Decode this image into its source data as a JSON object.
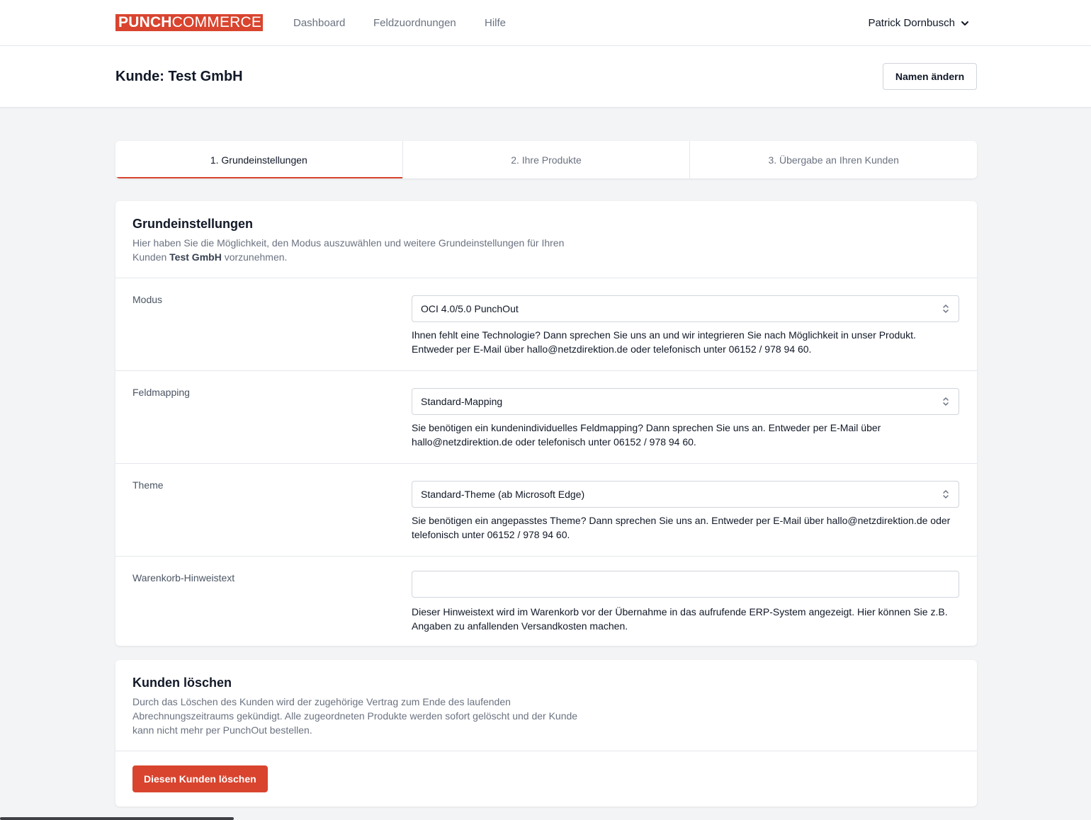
{
  "brand": {
    "logo_bold": "PUNCH",
    "logo_light": "COMMERCE",
    "color": "#d9442e"
  },
  "nav": {
    "links": [
      "Dashboard",
      "Feldzuordnungen",
      "Hilfe"
    ],
    "user": "Patrick Dornbusch"
  },
  "header": {
    "title": "Kunde: Test GmbH",
    "rename_button": "Namen ändern"
  },
  "steps": [
    {
      "label": "1. Grundeinstellungen",
      "active": true
    },
    {
      "label": "2. Ihre Produkte",
      "active": false
    },
    {
      "label": "3. Übergabe an Ihren Kunden",
      "active": false
    }
  ],
  "settings": {
    "title": "Grundeinstellungen",
    "desc_pre": "Hier haben Sie die Möglichkeit, den Modus auszuwählen und weitere Grundeinstellungen für Ihren Kunden ",
    "desc_bold": "Test GmbH",
    "desc_post": " vorzunehmen.",
    "rows": [
      {
        "label": "Modus",
        "value": "OCI 4.0/5.0 PunchOut",
        "help": "Ihnen fehlt eine Technologie? Dann sprechen Sie uns an und wir integrieren Sie nach Möglichkeit in unser Produkt. Entweder per E-Mail über hallo@netzdirektion.de oder telefonisch unter 06152 / 978 94 60."
      },
      {
        "label": "Feldmapping",
        "value": "Standard-Mapping",
        "help": "Sie benötigen ein kundenindividuelles Feldmapping? Dann sprechen Sie uns an. Entweder per E-Mail über hallo@netzdirektion.de oder telefonisch unter 06152 / 978 94 60."
      },
      {
        "label": "Theme",
        "value": "Standard-Theme (ab Microsoft Edge)",
        "help": "Sie benötigen ein angepasstes Theme? Dann sprechen Sie uns an. Entweder per E-Mail über hallo@netzdirektion.de oder telefonisch unter 06152 / 978 94 60."
      },
      {
        "label": "Warenkorb-Hinweistext",
        "value": "",
        "placeholder": "",
        "help": "Dieser Hinweistext wird im Warenkorb vor der Übernahme in das aufrufende ERP-System angezeigt. Hier können Sie z.B. Angaben zu anfallenden Versandkosten machen."
      }
    ]
  },
  "delete": {
    "title": "Kunden löschen",
    "desc": "Durch das Löschen des Kunden wird der zugehörige Vertrag zum Ende des laufenden Abrechnungszeitraums gekündigt. Alle zugeordneten Produkte werden sofort gelöscht und der Kunde kann nicht mehr per PunchOut bestellen.",
    "button": "Diesen Kunden löschen"
  }
}
